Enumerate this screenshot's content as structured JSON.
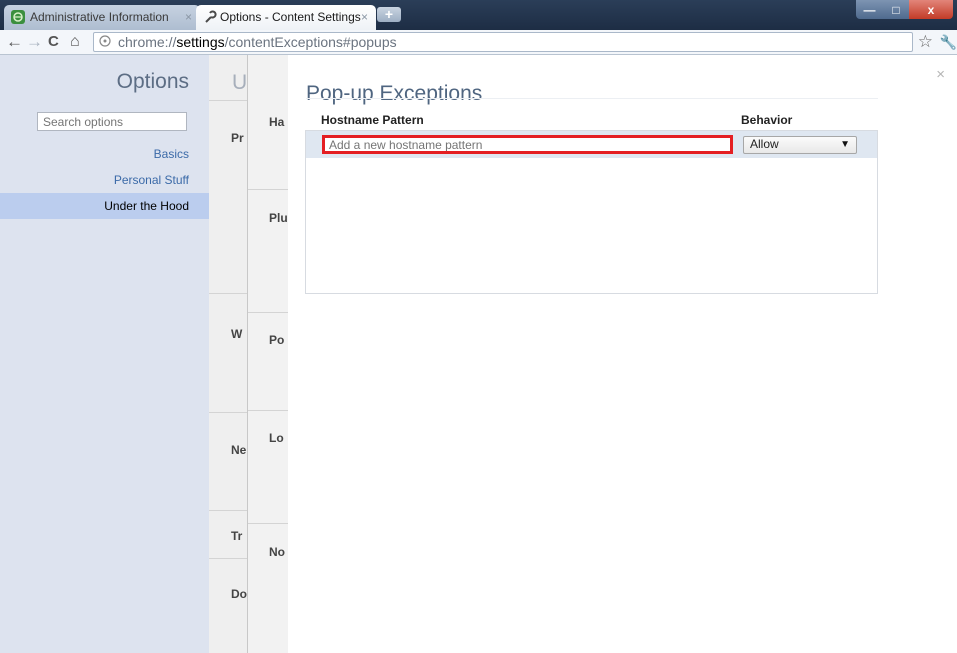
{
  "tabs": [
    {
      "title": "Administrative Information",
      "close": "×"
    },
    {
      "title": "Options - Content Settings",
      "close": "×"
    }
  ],
  "new_tab_label": "+",
  "window_controls": {
    "minimize": "—",
    "maximize": "□",
    "close": "x"
  },
  "address_bar": {
    "scheme": "chrome://",
    "host": "settings",
    "path": "/contentExceptions#popups"
  },
  "sidebar": {
    "title": "Options",
    "search_placeholder": "Search options",
    "items": [
      {
        "label": "Basics"
      },
      {
        "label": "Personal Stuff"
      },
      {
        "label": "Under the Hood",
        "selected": true
      }
    ]
  },
  "background_page": {
    "title": "U",
    "left_col": [
      "Pr",
      "W",
      "Ne",
      "Tr",
      "Do"
    ],
    "mid_col": [
      "Ha",
      "Plu",
      "Po",
      "Lo",
      "No"
    ]
  },
  "dialog": {
    "title": "Pop-up Exceptions",
    "close": "×",
    "columns": {
      "hostname": "Hostname Pattern",
      "behavior": "Behavior"
    },
    "new_row": {
      "hostname_placeholder": "Add a new hostname pattern",
      "behavior_value": "Allow"
    }
  },
  "colors": {
    "highlight_border": "#e41f23",
    "selected_nav": "#bbcdee",
    "title_blue": "#4f6580"
  }
}
